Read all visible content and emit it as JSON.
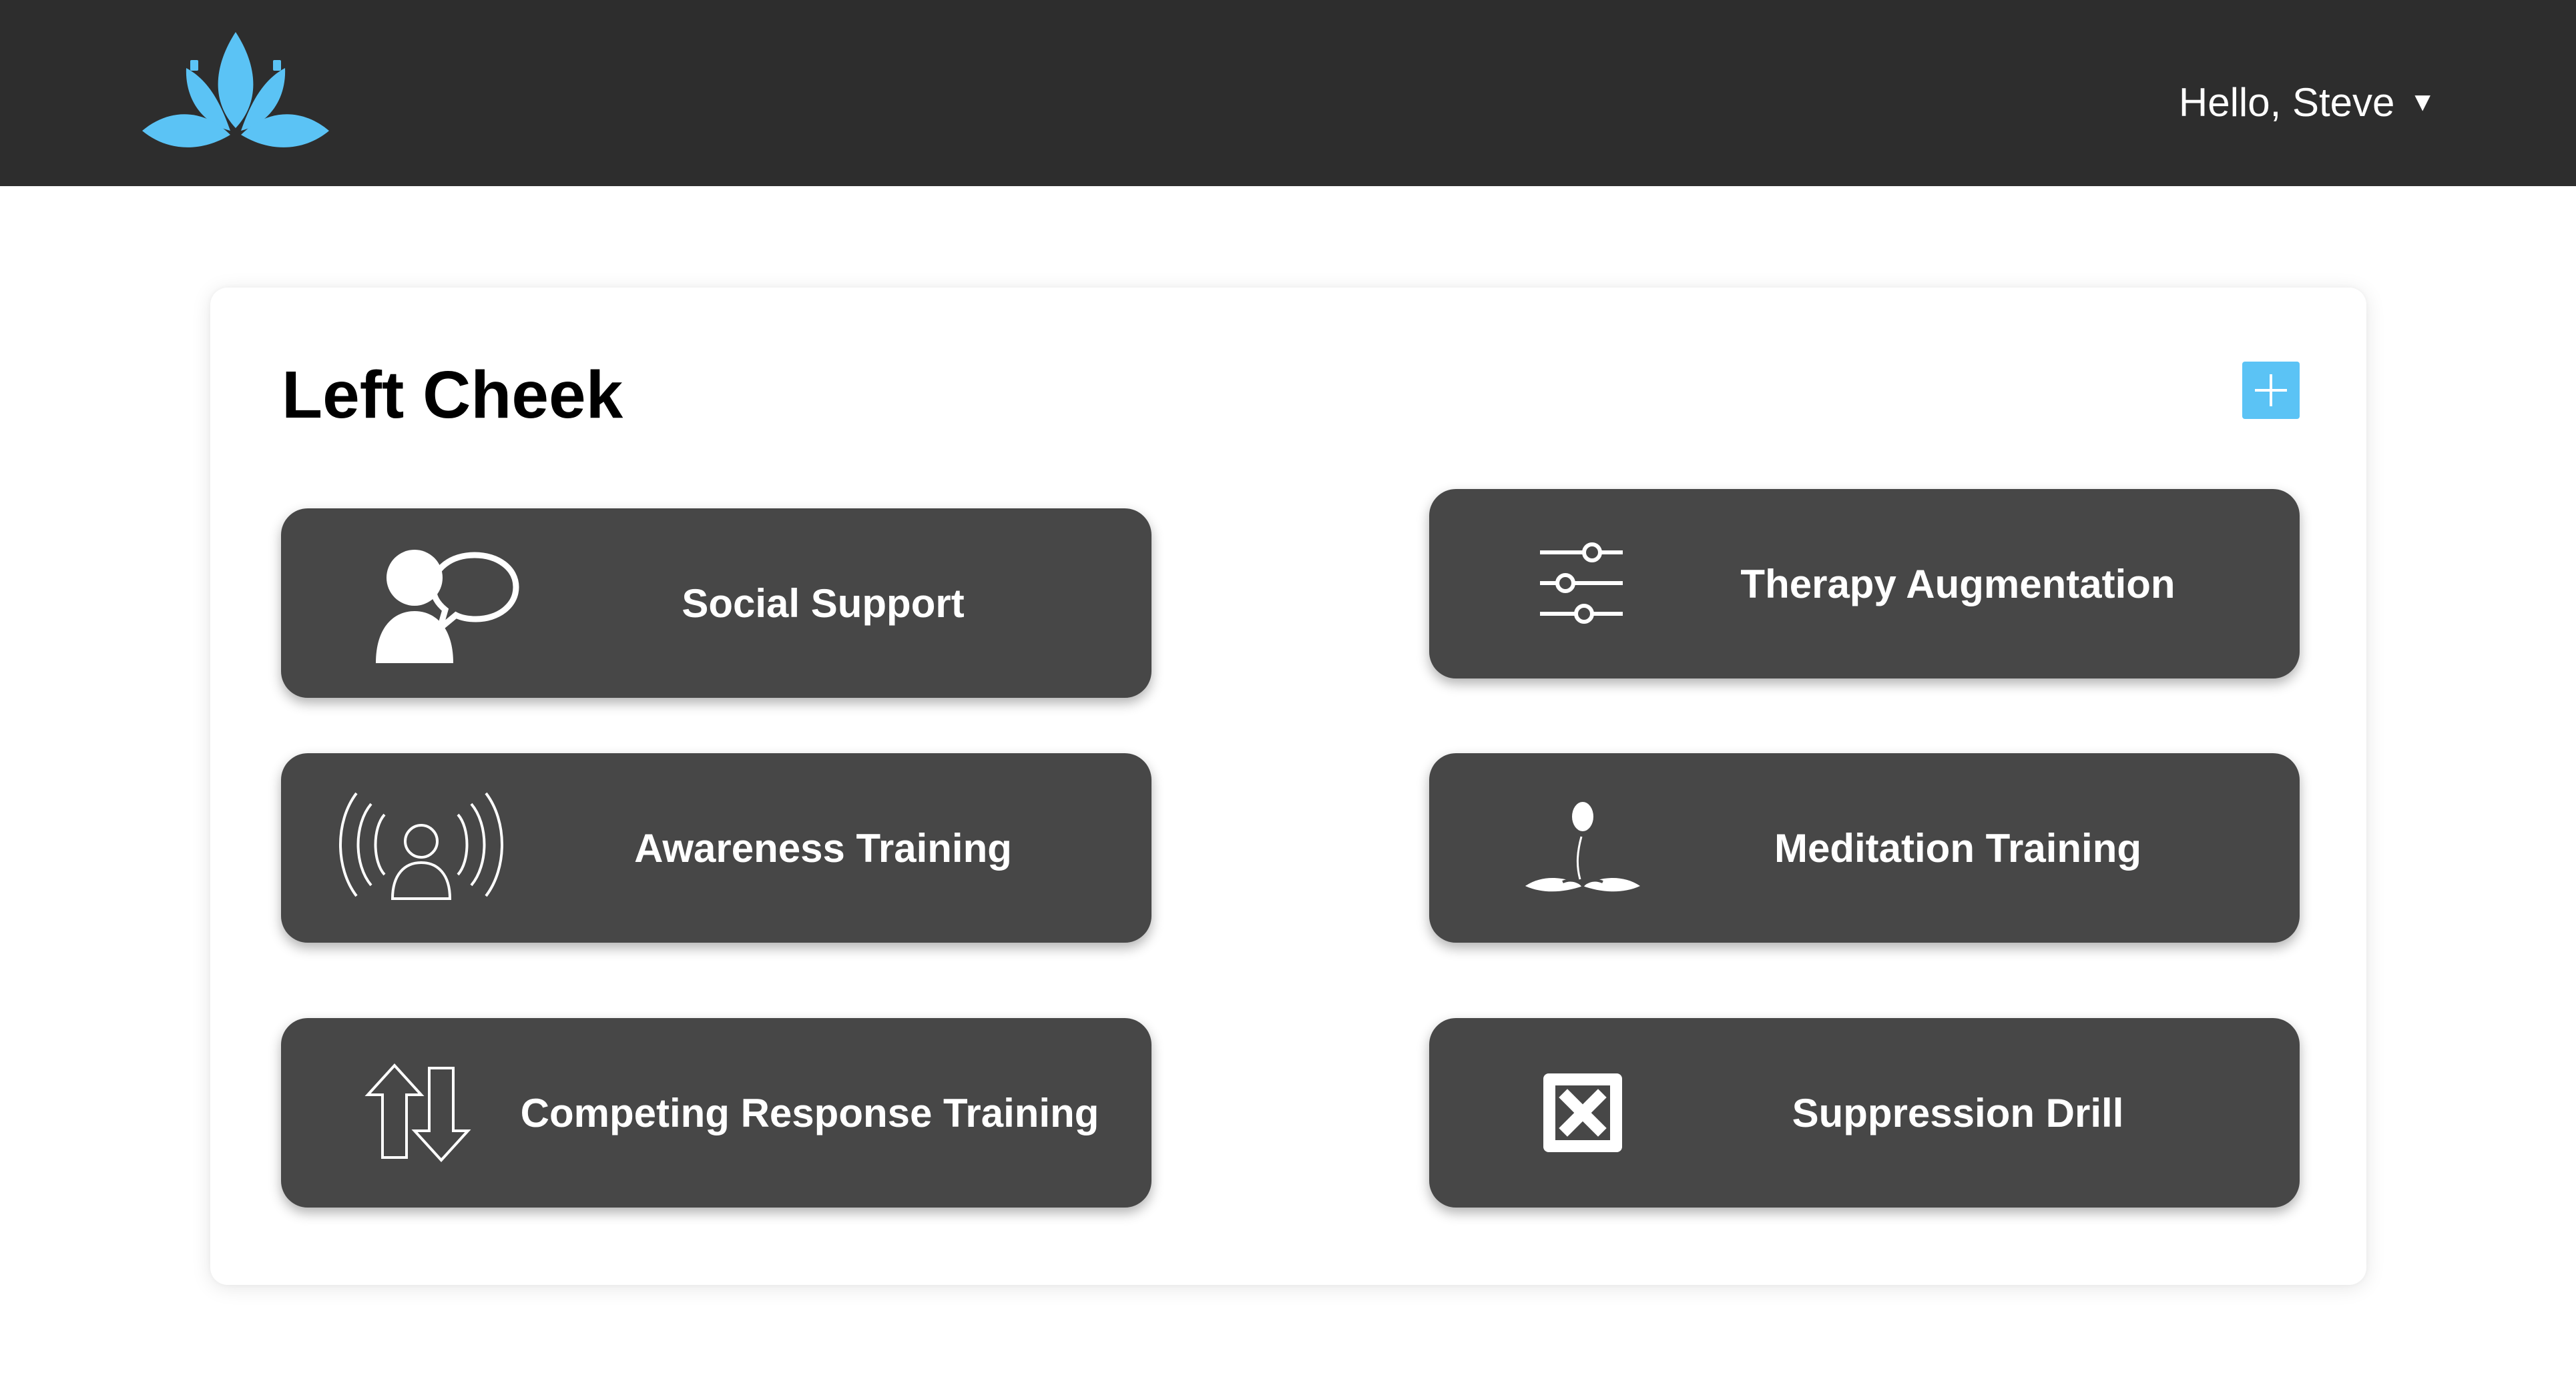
{
  "header": {
    "greeting": "Hello, Steve",
    "caret": "▼",
    "logo_icon": "lotus-logo-icon",
    "logo_color": "#5bc3f5",
    "background": "#2d2d2d"
  },
  "panel": {
    "title": "Left Cheek",
    "add_icon": "plus-icon",
    "accent": "#5bc3f5"
  },
  "tiles": [
    {
      "label": "Social Support",
      "icon": "person-speech-bubble-icon"
    },
    {
      "label": "Therapy Augmentation",
      "icon": "sliders-icon"
    },
    {
      "label": "Awareness Training",
      "icon": "person-waves-icon"
    },
    {
      "label": "Meditation Training",
      "icon": "meditation-icon"
    },
    {
      "label": "Competing Response Training",
      "icon": "up-down-arrows-icon"
    },
    {
      "label": "Suppression Drill",
      "icon": "x-box-icon"
    }
  ]
}
